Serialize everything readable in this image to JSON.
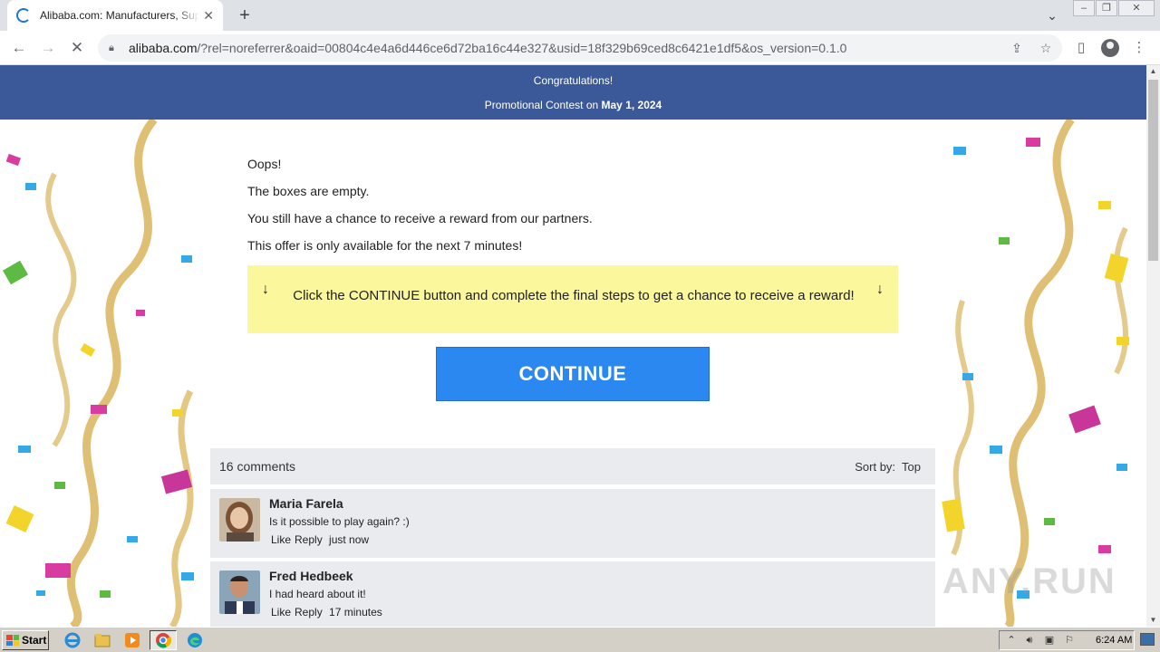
{
  "browser": {
    "tab_title": "Alibaba.com: Manufacturers, Suppliers, Exporters & Importers",
    "tab_close": "✕",
    "new_tab": "+",
    "url_domain": "alibaba.com",
    "url_rest": "/?rel=noreferrer&oaid=00804c4e4a6d446ce6d72ba16c44e327&usid=18f329b69ced8c6421e1df5&os_version=0.1.0",
    "window_controls": [
      "–",
      "❐",
      "✕"
    ]
  },
  "page": {
    "banner_line1": "Congratulations!",
    "banner_line2_prefix": "Promotional Contest on",
    "banner_date": "May 1, 2024",
    "messages": [
      "Oops!",
      "The boxes are empty.",
      "You still have a chance to receive a reward from our partners.",
      "This offer is only available for the next 7 minutes!"
    ],
    "notice_text": "Click the CONTINUE button and complete the final steps to get a chance to receive a reward!",
    "notice_arrow": "↓",
    "continue_label": "CONTINUE",
    "comments_count": "16 comments",
    "sort_label": "Sort by:",
    "sort_value": "Top",
    "comments": [
      {
        "name": "Maria Farela",
        "text": "Is it possible to play again? :)",
        "like": "Like",
        "reply": "Reply",
        "time": "just now"
      },
      {
        "name": "Fred Hedbeek",
        "text": "I had heard about it!",
        "like": "Like",
        "reply": "Reply",
        "time": "17 minutes"
      }
    ],
    "watermark": "ANY.RUN"
  },
  "taskbar": {
    "start_label": "Start",
    "clock": "6:24 AM",
    "apps": [
      "internet-explorer-icon",
      "folder-icon",
      "media-player-icon",
      "chrome-icon",
      "edge-icon"
    ]
  },
  "colors": {
    "banner_bg": "#3b5998",
    "continue_bg": "#2b88f0",
    "notice_bg": "#fbf79c",
    "comments_bg": "#e9ebee"
  }
}
